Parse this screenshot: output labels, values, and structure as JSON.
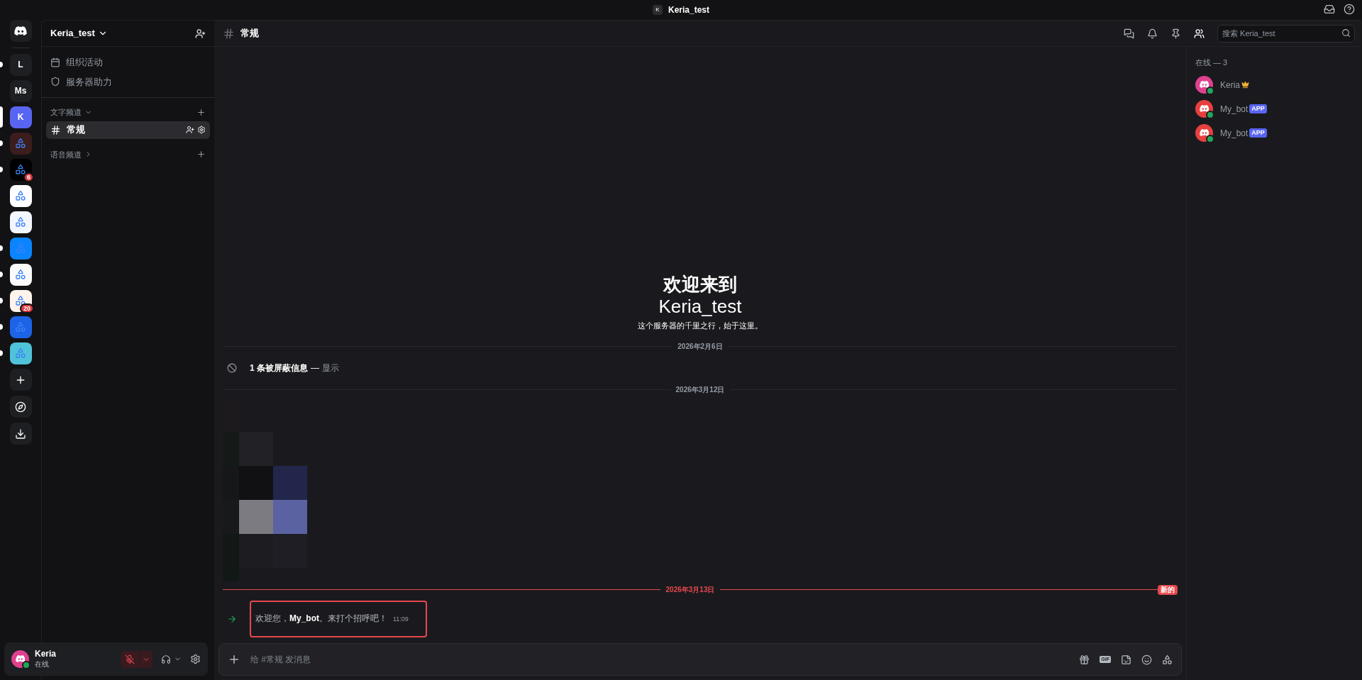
{
  "titlebar": {
    "server_initial": "K",
    "title": "Keria_test"
  },
  "servers": [
    {
      "kind": "letter",
      "label": "L",
      "unread": true,
      "selected": false
    },
    {
      "kind": "letter",
      "label": "Ms",
      "unread": false,
      "selected": false
    },
    {
      "kind": "letter",
      "label": "K",
      "unread": false,
      "selected": true
    },
    {
      "kind": "app",
      "color": "#3b1d1d",
      "unread": true,
      "selected": false
    },
    {
      "kind": "app",
      "color": "#000000",
      "unread": true,
      "selected": false,
      "badge": "6"
    },
    {
      "kind": "app",
      "color": "#ffffff",
      "unread": false,
      "selected": false
    },
    {
      "kind": "app",
      "color": "#f2f6ff",
      "unread": false,
      "selected": false
    },
    {
      "kind": "app",
      "color": "#0a84ff",
      "unread": true,
      "selected": false
    },
    {
      "kind": "app",
      "color": "#fafafa",
      "unread": true,
      "selected": false
    },
    {
      "kind": "app",
      "color": "#fff4ec",
      "unread": true,
      "selected": false,
      "badge": "20"
    },
    {
      "kind": "app",
      "color": "#1d63e8",
      "unread": true,
      "selected": false
    },
    {
      "kind": "app",
      "color": "#4fc3d9",
      "unread": true,
      "selected": false
    }
  ],
  "server": {
    "name": "Keria_test"
  },
  "shortcuts": [
    {
      "kind": "events",
      "label": "组织活动"
    },
    {
      "kind": "boost",
      "label": "服务器助力"
    }
  ],
  "categories": [
    {
      "label": "文字频道",
      "expanded": true,
      "channels": [
        {
          "name": "常规",
          "selected": true
        }
      ]
    },
    {
      "label": "语音频道",
      "expanded": false
    }
  ],
  "user": {
    "name": "Keria",
    "status_text": "在线",
    "online": true,
    "muted": true
  },
  "channel_header": {
    "name": "常规",
    "search_placeholder": "搜索 Keria_test"
  },
  "welcome": {
    "title": "欢迎来到",
    "server": "Keria_test",
    "subtitle": "这个服务器的千里之行，始于这里。"
  },
  "messages": [
    {
      "kind": "date",
      "text": "2026年2月6日"
    },
    {
      "kind": "blocked",
      "text": "1 条被屏蔽信息",
      "dash": "—",
      "link": "显示"
    },
    {
      "kind": "date",
      "text": "2026年3月12日"
    },
    {
      "kind": "picture"
    },
    {
      "kind": "new_date",
      "text": "2026年3月13日",
      "badge": "新的"
    },
    {
      "kind": "join",
      "text": "欢迎您，**My_bot**。来打个招呼吧！",
      "time": "11:09",
      "highlighted": true
    }
  ],
  "composer": {
    "placeholder": "给 #常规 发消息",
    "gif_label": "GIF"
  },
  "members": {
    "heading": "在线 — 3",
    "list": [
      {
        "name": "Keria",
        "color": "#e0418f",
        "online": true,
        "owner": true
      },
      {
        "name": "My_bot",
        "color": "#e8403f",
        "online": true,
        "owner": false,
        "tag": "APP"
      },
      {
        "name": "My_bot",
        "color": "#e8403f",
        "online": true,
        "owner": false,
        "tag": "APP"
      }
    ]
  }
}
